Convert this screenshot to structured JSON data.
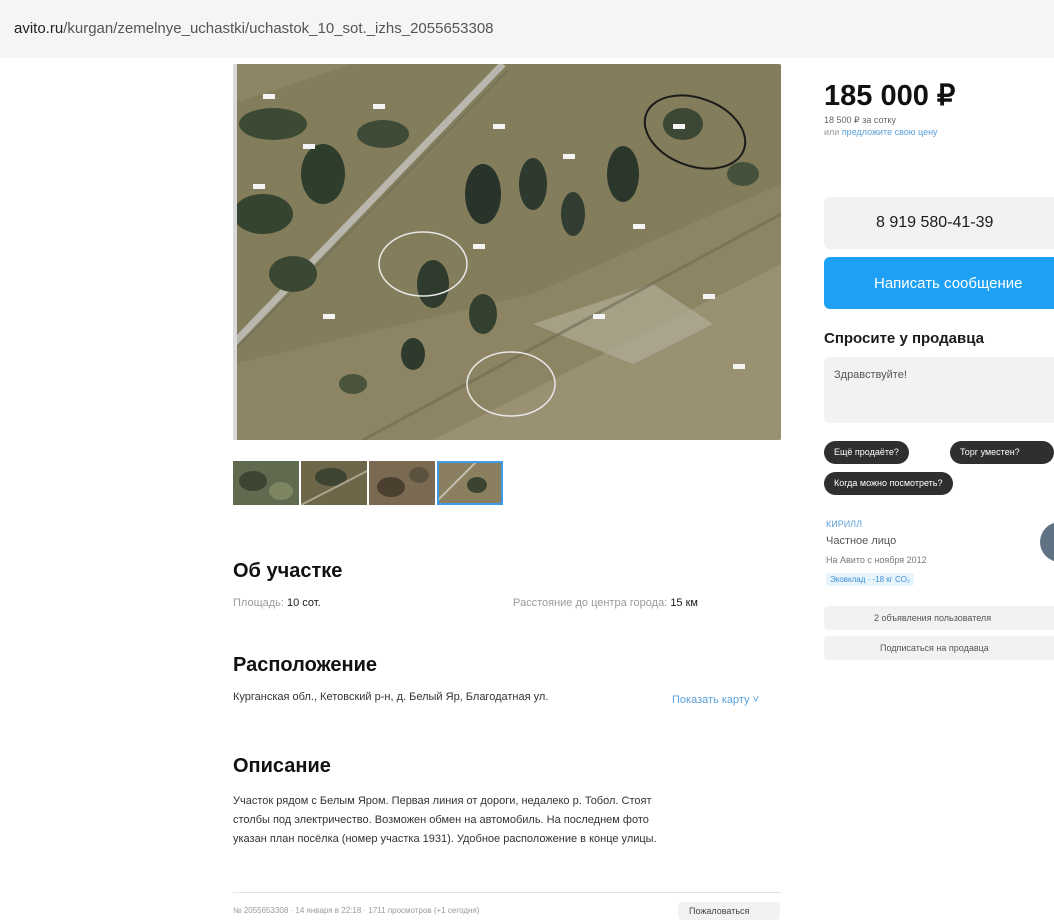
{
  "browser": {
    "url_domain": "avito.ru",
    "url_path": "/kurgan/zemelnye_uchastki/uchastok_10_sot._izhs_2055653308"
  },
  "listing": {
    "price": "185 000 ₽",
    "price_per_sotka": "18 500 ₽ за сотку",
    "offer_prefix": "или ",
    "offer_link": "предложите свою цену",
    "phone": "8 919 580-41-39",
    "message_button": "Написать сообщение"
  },
  "ask": {
    "title": "Спросите у продавца",
    "placeholder": "Здравствуйте!",
    "chips": [
      "Ещё продаёте?",
      "Торг уместен?",
      "Когда можно посмотреть?"
    ]
  },
  "seller": {
    "name": "КИРИЛЛ",
    "type": "Частное лицо",
    "since": "На Авито с ноября 2012",
    "eco": "Эковклад · -18 кг CO₂",
    "listings_button": "2 объявления пользователя",
    "subscribe_button": "Подписаться на продавца"
  },
  "about": {
    "title": "Об участке",
    "area_label": "Площадь:",
    "area_value": "10 сот.",
    "distance_label": "Расстояние до центра города:",
    "distance_value": "15 км"
  },
  "location": {
    "title": "Расположение",
    "address": "Курганская обл., Кетовский р-н, д. Белый Яр, Благодатная ул.",
    "map_link": "Показать карту ˅"
  },
  "description": {
    "title": "Описание",
    "lines": [
      "Участок рядом с Белым Яром. Первая линия от дороги, недалеко р. Тобол. Стоят",
      "столбы под электричество. Возможен обмен на автомобиль. На последнем фото",
      "указан план посёлка (номер участка 1931). Удобное расположение в конце улицы."
    ]
  },
  "footer": {
    "meta": "№ 2055653308 · 14 января в 22:18 · 1711 просмотров (+1 сегодня)",
    "report": "Пожаловаться"
  },
  "gallery": {
    "thumbnail_count": 4,
    "selected_index": 3
  },
  "colors": {
    "accent_blue": "#1ea0f5",
    "link_blue": "#5a9fd8",
    "chip_dark": "#2f2f2f",
    "button_grey": "#f2f2f2"
  }
}
